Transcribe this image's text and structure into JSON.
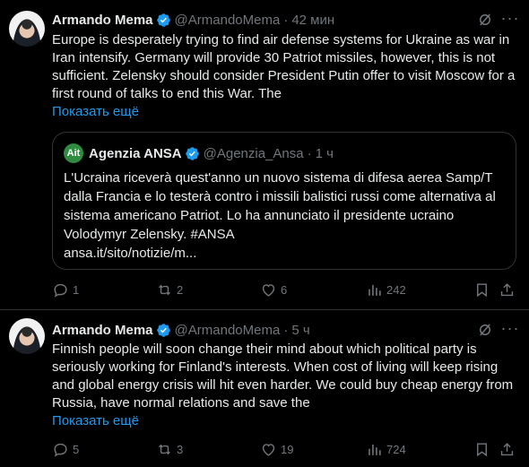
{
  "tweets": [
    {
      "author": "Armando Mema",
      "handle": "@ArmandoMema",
      "time": "42 мин",
      "text": "Europe is desperately trying to find air defense systems for Ukraine as war in Iran intensify. Germany will provide 30 Patriot missiles, however, this is not sufficient. Zelensky should consider President Putin offer to visit Moscow for a first round of talks to end this War. The",
      "show_more": "Показать ещё",
      "quote": {
        "avatar_text": "Ait",
        "author": "Agenzia ANSA",
        "handle": "@Agenzia_Ansa",
        "time": "1 ч",
        "text": "L'Ucraina riceverà quest'anno un nuovo sistema di difesa aerea Samp/T dalla Francia e lo testerà contro i missili balistici russi come alternativa al sistema americano Patriot. Lo ha annunciato il presidente ucraino Volodymyr Zelensky. #ANSA",
        "link": "ansa.it/sito/notizie/m..."
      },
      "replies": "1",
      "retweets": "2",
      "likes": "6",
      "views": "242"
    },
    {
      "author": "Armando Mema",
      "handle": "@ArmandoMema",
      "time": "5 ч",
      "text": "Finnish people will soon change their mind about which political party is seriously working for Finland's interests. When cost of living will keep rising and global energy crisis will hit even harder. We could buy cheap energy from Russia, have normal relations and save the",
      "show_more": "Показать ещё",
      "replies": "5",
      "retweets": "3",
      "likes": "19",
      "views": "724"
    }
  ],
  "icons": {
    "verified": "verified-badge-icon",
    "grok": "grok-icon",
    "more": "more-icon",
    "reply": "reply-icon",
    "retweet": "retweet-icon",
    "like": "like-icon",
    "views": "views-icon",
    "bookmark": "bookmark-icon",
    "share": "share-icon"
  },
  "colors": {
    "background": "#000000",
    "text": "#e7e9ea",
    "muted": "#71767b",
    "accent": "#1d9bf0",
    "border": "#2f3336",
    "verified": "#1d9bf0",
    "ansa_green": "#2e8b3f"
  }
}
